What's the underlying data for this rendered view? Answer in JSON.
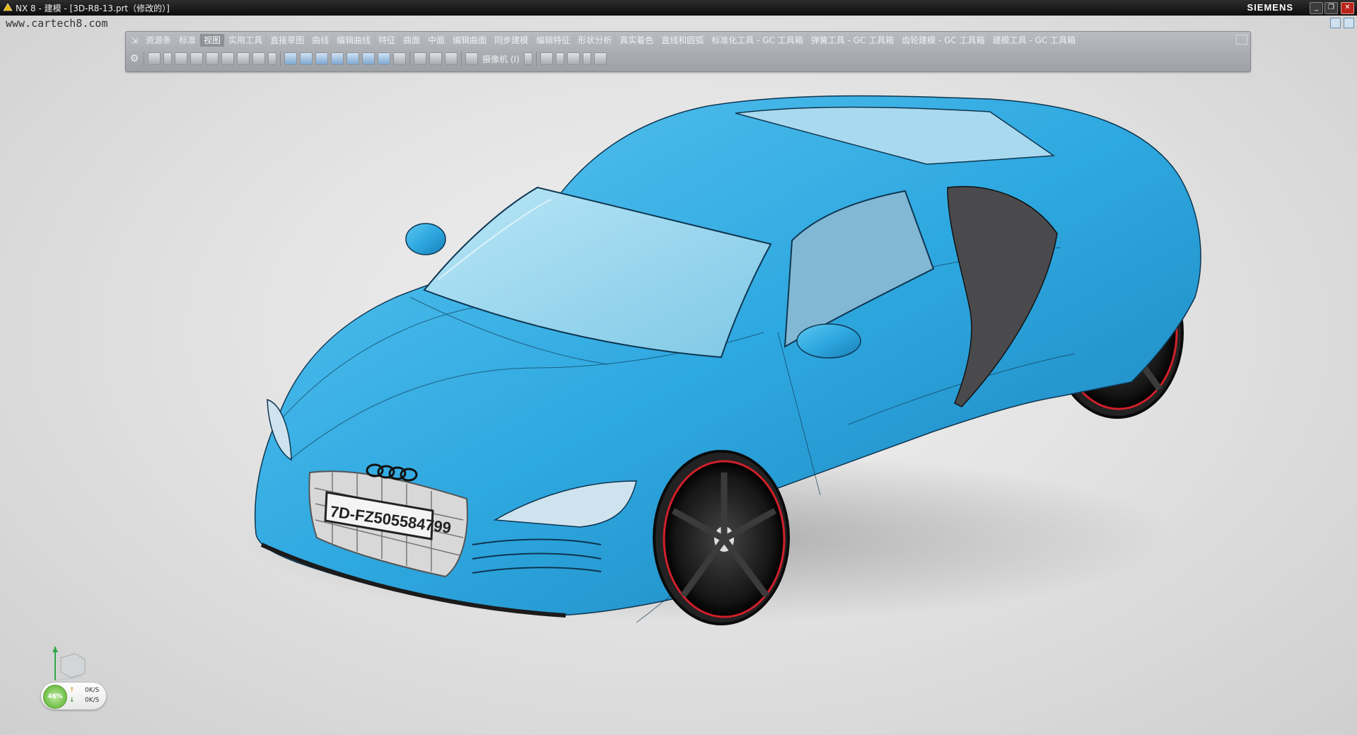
{
  "window": {
    "title": "NX 8 - 建模 - [3D-R8-13.prt（修改的）]",
    "brand": "SIEMENS",
    "controls": {
      "minimize": "_",
      "restore": "❐",
      "close": "✕"
    }
  },
  "watermark": "www.cartech8.com",
  "toolbar": {
    "tabs": [
      {
        "label": "资源条"
      },
      {
        "label": "标准"
      },
      {
        "label": "视图",
        "active": true
      },
      {
        "label": "实用工具"
      },
      {
        "label": "直接草图"
      },
      {
        "label": "曲线"
      },
      {
        "label": "编辑曲线"
      },
      {
        "label": "特征"
      },
      {
        "label": "曲面"
      },
      {
        "label": "中面"
      },
      {
        "label": "编辑曲面"
      },
      {
        "label": "同步建模"
      },
      {
        "label": "编辑特征"
      },
      {
        "label": "形状分析"
      },
      {
        "label": "真实着色"
      },
      {
        "label": "直线和圆弧"
      },
      {
        "label": "标准化工具 - GC 工具箱"
      },
      {
        "label": "弹簧工具 - GC 工具箱"
      },
      {
        "label": "齿轮建模 - GC 工具箱"
      },
      {
        "label": "建模工具 - GC 工具箱"
      }
    ],
    "camera_dropdown": "摄像机 (I)"
  },
  "model": {
    "license_plate": "7D-FZ505584799",
    "body_color": "#2fa8e0",
    "rim_color": "#d0202a"
  },
  "performance": {
    "percent": "46%",
    "upload": "0K/S",
    "download": "0K/S"
  }
}
